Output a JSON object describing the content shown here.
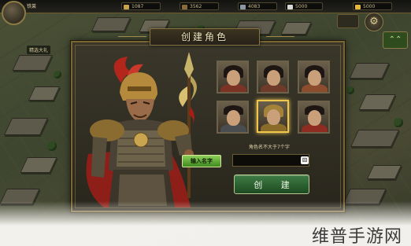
{
  "top_bar": {
    "player_name": "铁莱",
    "resources": [
      {
        "icon": "grain-icon",
        "value": "1087",
        "color": "#c9a34a"
      },
      {
        "icon": "wood-icon",
        "value": "3562",
        "color": "#8a6a3a"
      },
      {
        "icon": "iron-icon",
        "value": "4083",
        "color": "#8d9aa6"
      },
      {
        "icon": "silver-icon",
        "value": "5000",
        "color": "#d8d8d8"
      },
      {
        "icon": "gold-icon",
        "value": "5000",
        "color": "#e4b838"
      }
    ],
    "level_badge": "精选大礼"
  },
  "dialog": {
    "title": "创建角色",
    "name_hint": "角色名不大于7个字",
    "name_label": "输入名字",
    "name_value": "",
    "create_button": "创 建",
    "selected_portrait": 4,
    "portraits": [
      {
        "face": "female-1",
        "body_color": "#7b3326"
      },
      {
        "face": "female-2",
        "body_color": "#6e3a2a"
      },
      {
        "face": "female-3",
        "body_color": "#8c4d2e"
      },
      {
        "face": "male-1",
        "body_color": "#4a4d4f"
      },
      {
        "face": "male-2",
        "body_color": "#8a6b2a"
      },
      {
        "face": "male-3",
        "body_color": "#8f2c22"
      }
    ]
  },
  "watermark": "维普手游网",
  "colors": {
    "accent_gold": "#f0c74a",
    "button_green": "#2f6a34",
    "label_green": "#6bb23a"
  }
}
